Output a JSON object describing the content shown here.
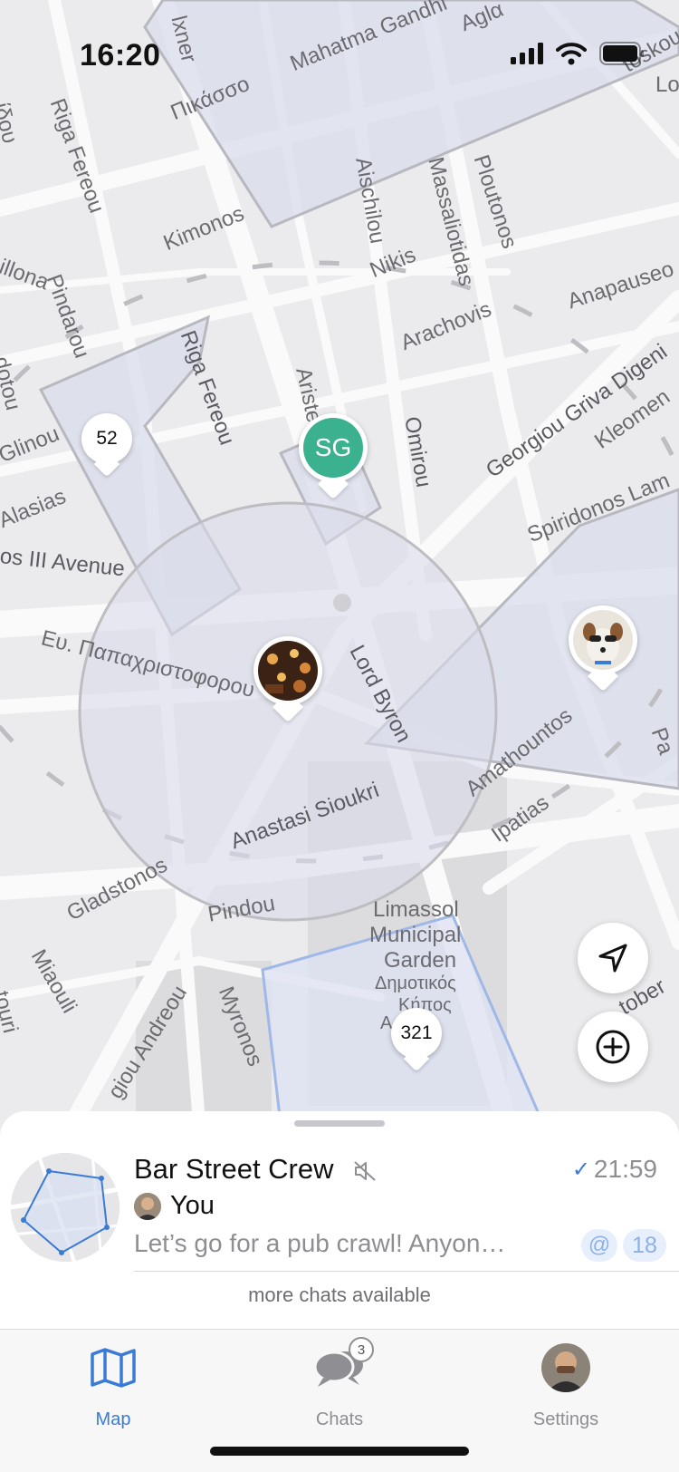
{
  "status_bar": {
    "time": "16:20"
  },
  "map": {
    "street_labels": [
      "Mahatma Gandhi",
      "Πικάσσο",
      "Riga Fereou",
      "Kimonos",
      "Aischilou",
      "Massaliotidas",
      "Ploutonos",
      "Nikis",
      "Anapauseo",
      "Arachovis",
      "Pindarou",
      "Riga Fereou",
      "Aristei",
      "Omirou",
      "Georgiou Griva Digeni",
      "Kleomen",
      "Glinou",
      "Alasias",
      "Spiridonos Lam",
      "os III Avenue",
      "Ευ. Παπαχριστοφορου",
      "Lord Byron",
      "Amathountos",
      "Ipatias",
      "Anastasi Sioukri",
      "Gladstonos",
      "Pindou",
      "Miaouli",
      "Myronos",
      "giou Andreou",
      "tober",
      "Limassol",
      "Municipal",
      "Garden",
      "Δημοτικός",
      "Κήπος",
      "Α",
      "illona",
      "dotou",
      "ίδου",
      "lxner",
      "Aglα",
      "toskou",
      "touri",
      "Pa",
      "Lo"
    ],
    "pins": {
      "cluster_52": "52",
      "cluster_321": "321",
      "user_sg": "SG"
    },
    "locate_button_icon": "navigation-arrow-icon",
    "add_button_icon": "plus-circle-icon"
  },
  "chat_sheet": {
    "title": "Bar Street Crew",
    "time": "21:59",
    "check": "✓",
    "sender": "You",
    "preview": "Let’s go for a pub crawl! Anyon…",
    "mention_badge": "@",
    "unread_count": "18",
    "more": "more chats available"
  },
  "tabbar": {
    "tabs": [
      {
        "label": "Map",
        "icon": "map-icon",
        "active": true
      },
      {
        "label": "Chats",
        "icon": "chat-bubbles-icon",
        "badge": "3"
      },
      {
        "label": "Settings",
        "icon": "profile-avatar-icon"
      }
    ]
  },
  "colors": {
    "accent": "#3a7bd5",
    "sg_avatar": "#3bb190",
    "map_bg": "#ebebed",
    "zone_fill": "#dde0ec"
  }
}
